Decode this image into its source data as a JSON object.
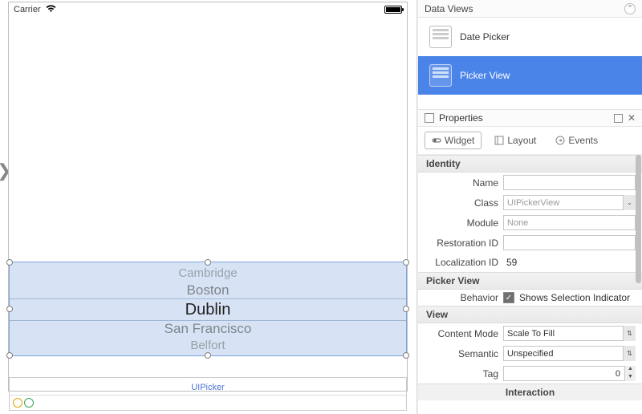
{
  "statusbar": {
    "carrier": "Carrier"
  },
  "picker": {
    "items": [
      "Cambridge",
      "Boston",
      "Dublin",
      "San Francisco",
      "Belfort"
    ],
    "selected_index": 2,
    "widget_label": "UIPicker"
  },
  "dataviews": {
    "header": "Data Views",
    "items": [
      {
        "label": "Date Picker",
        "selected": false
      },
      {
        "label": "Picker View",
        "selected": true
      }
    ]
  },
  "properties": {
    "header": "Properties",
    "tabs": {
      "widget": "Widget",
      "layout": "Layout",
      "events": "Events",
      "active": "widget"
    },
    "identity": {
      "header": "Identity",
      "name_label": "Name",
      "name_value": "",
      "class_label": "Class",
      "class_value": "UIPickerView",
      "module_label": "Module",
      "module_value": "None",
      "restoration_label": "Restoration ID",
      "restoration_value": "",
      "localization_label": "Localization ID",
      "localization_value": "59"
    },
    "pickerview": {
      "header": "Picker View",
      "behavior_label": "Behavior",
      "shows_indicator_label": "Shows Selection Indicator",
      "shows_indicator_checked": true
    },
    "view": {
      "header": "View",
      "content_mode_label": "Content Mode",
      "content_mode_value": "Scale To Fill",
      "semantic_label": "Semantic",
      "semantic_value": "Unspecified",
      "tag_label": "Tag",
      "tag_value": "0",
      "interaction_header": "Interaction"
    }
  }
}
